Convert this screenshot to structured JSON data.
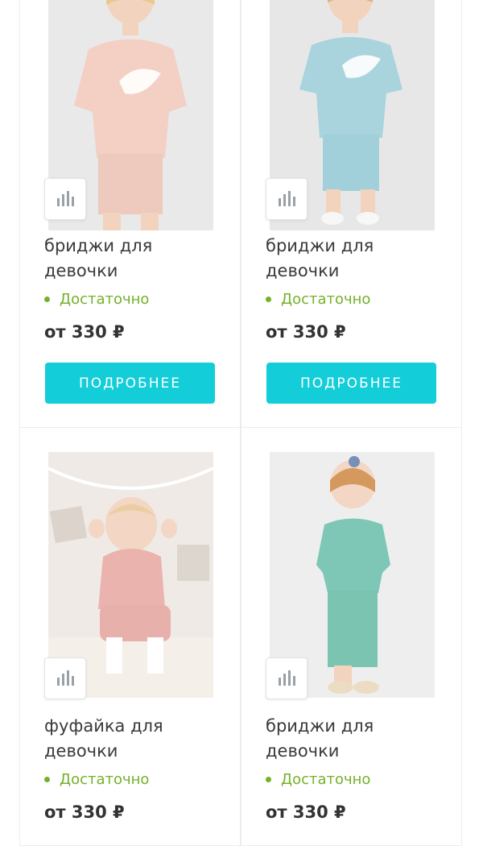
{
  "products": [
    {
      "title": "бриджи для девочки",
      "stock": "Достаточно",
      "price": "от 330 ₽",
      "button": "ПОДРОБНЕЕ",
      "shirt_color": "#f3cfc4",
      "shorts_color": "#eec9bd"
    },
    {
      "title": "бриджи для девочки",
      "stock": "Достаточно",
      "price": "от 330 ₽",
      "button": "ПОДРОБНЕЕ",
      "shirt_color": "#a9d4dd",
      "shorts_color": "#a2d0da"
    },
    {
      "title": "фуфайка для девочки",
      "stock": "Достаточно",
      "price": "от 330 ₽",
      "shirt_color": "#eab3ad",
      "shorts_color": "#e8b0aa"
    },
    {
      "title": "бриджи для девочки",
      "stock": "Достаточно",
      "price": "от 330 ₽",
      "shirt_color": "#7ec7b6",
      "shorts_color": "#7cc4b2"
    }
  ],
  "colors": {
    "accent": "#13cdd9",
    "stock_green": "#74b12a"
  },
  "icons": {
    "compare": "bar-chart-icon"
  }
}
